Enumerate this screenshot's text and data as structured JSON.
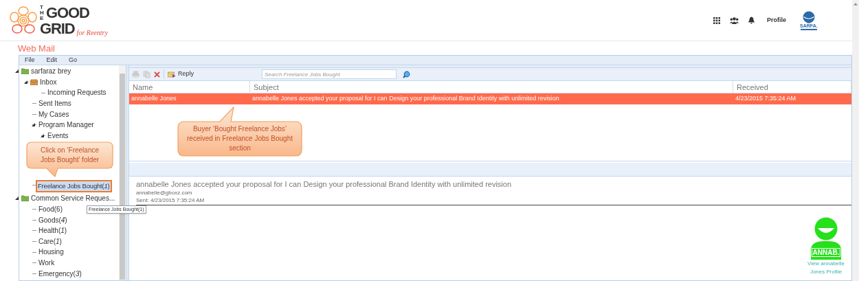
{
  "logo": {
    "the": "THE",
    "good": "GOOD",
    "grid": "GRID",
    "tagline": "for Reentry"
  },
  "header": {
    "profile_label": "Profile",
    "avatar_badge": "SARFA."
  },
  "page_title": "Web Mail",
  "menu": [
    "File",
    "Edit",
    "Go"
  ],
  "folders": [
    {
      "label": "sarfaraz brey",
      "kind": "folder",
      "expanded": true,
      "selected": false,
      "children": [
        {
          "label": "Inbox",
          "kind": "inbox",
          "expanded": true,
          "selected": false,
          "children": [
            {
              "label": "Incoming Requests",
              "kind": "plain",
              "selected": false
            }
          ]
        },
        {
          "label": "Sent Items",
          "kind": "plain",
          "selected": false
        },
        {
          "label": "My Cases",
          "kind": "plain",
          "selected": false
        },
        {
          "label": "Program Manager",
          "kind": "plain",
          "expanded": true,
          "selected": false,
          "children": [
            {
              "label": "Events",
              "kind": "plain",
              "expanded": true,
              "selected": false
            }
          ]
        },
        {
          "label": "Freelance Jobs Bought(*1*)",
          "kind": "plain",
          "selected": true
        }
      ]
    },
    {
      "label": "Common Service Reques...",
      "kind": "folder",
      "expanded": true,
      "selected": false,
      "children": [
        {
          "label": "Food(6)",
          "kind": "plain",
          "selected": false
        },
        {
          "label": "Goods(*4*)",
          "kind": "plain",
          "selected": false
        },
        {
          "label": "Health(*1*)",
          "kind": "plain",
          "selected": false
        },
        {
          "label": "Care(*1*)",
          "kind": "plain",
          "selected": false
        },
        {
          "label": "Housing",
          "kind": "plain",
          "selected": false
        },
        {
          "label": "Work",
          "kind": "plain",
          "selected": false
        },
        {
          "label": "Emergency(*3*)",
          "kind": "plain",
          "selected": false
        }
      ]
    }
  ],
  "tooltip": "Freelance Jobs Bought(1)",
  "toolbar": {
    "reply": "Reply",
    "search_placeholder": "Search Freelance Jobs Bought"
  },
  "table": {
    "columns": [
      "Name",
      "Subject",
      "Received"
    ],
    "rows": [
      {
        "name": "annabelle Jones",
        "subject": "annabelle Jones accepted your proposal for I can Design your professional Brand Identity with unlimited revision",
        "received": "4/23/2015 7:35:24 AM",
        "selected": true
      }
    ]
  },
  "callouts": [
    {
      "text": "Click on ‘Freelance Jobs Bought’ folder"
    },
    {
      "text": "Buyer ‘Bought Freelance Jobs’ received in Freelance Jobs Bought section"
    }
  ],
  "preview": {
    "subject": "annabelle Jones accepted your proposal for I can Design your professional Brand Identity with unlimited revision",
    "from": "annabelle@gboxz.com",
    "sent": "Sent: 4/23/2015 7:35:24 AM"
  },
  "contact": {
    "badge": "ANNAB.",
    "link": "View annabelle Jones Profile"
  }
}
